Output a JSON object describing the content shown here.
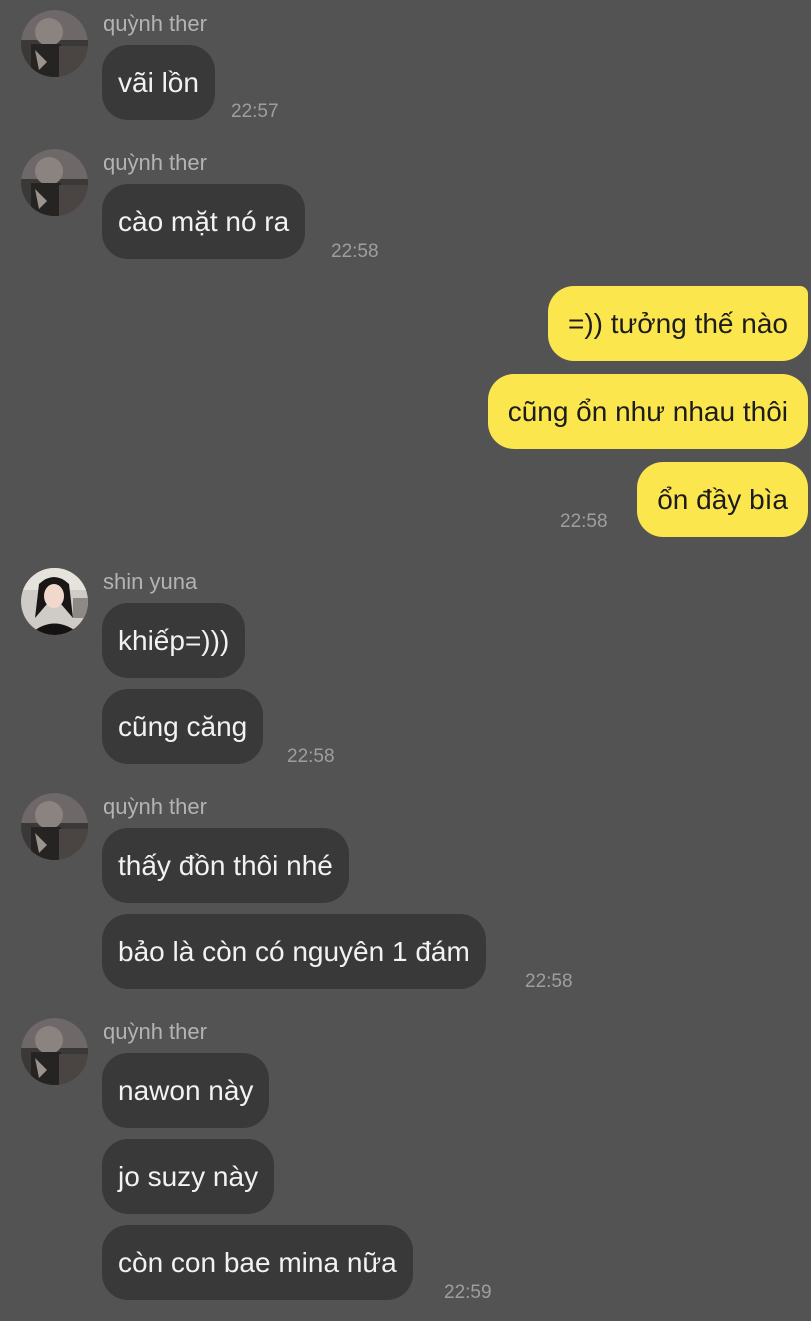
{
  "colors": {
    "background": "#545354",
    "incoming_bubble": "#3a393a",
    "outgoing_bubble": "#fbe64d",
    "sender_name": "#b4b3b4",
    "timestamp": "#9f9e9f"
  },
  "messages": {
    "g1": {
      "sender": "quỳnh ther",
      "avatar": "user-avatar-quynh-ther",
      "bubbles": [
        "vãi lồn"
      ],
      "time": "22:57"
    },
    "g2": {
      "sender": "quỳnh ther",
      "avatar": "user-avatar-quynh-ther",
      "bubbles": [
        "cào mặt nó ra"
      ],
      "time": "22:58"
    },
    "g3": {
      "sender": "",
      "outgoing": true,
      "bubbles": [
        "=)) tưởng thế nào",
        "cũng ổn như nhau thôi",
        "ổn đầy bìa"
      ],
      "time": "22:58"
    },
    "g4": {
      "sender": "shin yuna",
      "avatar": "user-avatar-shin-yuna",
      "bubbles": [
        "khiếp=)))",
        "cũng căng"
      ],
      "time": "22:58"
    },
    "g5": {
      "sender": "quỳnh ther",
      "avatar": "user-avatar-quynh-ther",
      "bubbles": [
        "thấy đồn thôi nhé",
        "bảo là còn có nguyên 1 đám"
      ],
      "time": "22:58"
    },
    "g6": {
      "sender": "quỳnh ther",
      "avatar": "user-avatar-quynh-ther",
      "bubbles": [
        "nawon này",
        "jo suzy này",
        "còn con bae mina nữa"
      ],
      "time": "22:59"
    }
  }
}
